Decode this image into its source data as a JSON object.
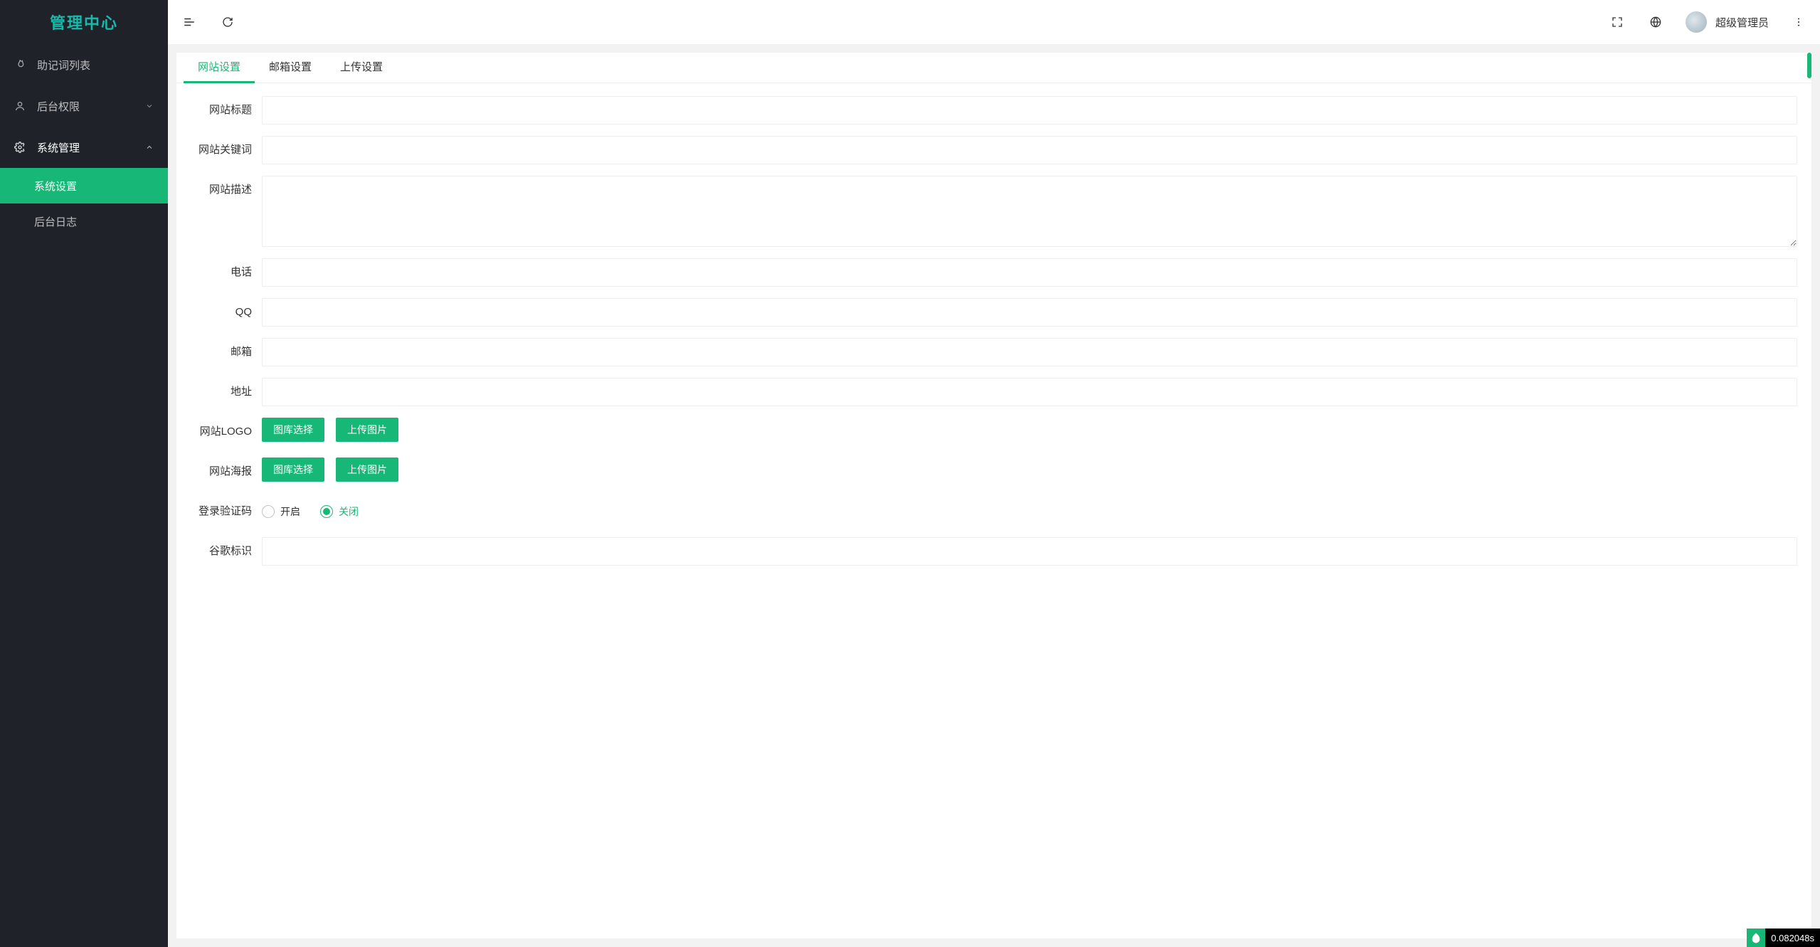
{
  "brand": {
    "title": "管理中心"
  },
  "sidebar": {
    "items": [
      {
        "label": "助记词列表",
        "icon": "flame",
        "expandable": false
      },
      {
        "label": "后台权限",
        "icon": "user",
        "expandable": true,
        "open": false
      },
      {
        "label": "系统管理",
        "icon": "gear",
        "expandable": true,
        "open": true,
        "children": [
          {
            "label": "系统设置",
            "active": true
          },
          {
            "label": "后台日志",
            "active": false
          }
        ]
      }
    ]
  },
  "topbar": {
    "username": "超级管理员"
  },
  "tabs": [
    {
      "label": "网站设置",
      "active": true
    },
    {
      "label": "邮箱设置",
      "active": false
    },
    {
      "label": "上传设置",
      "active": false
    }
  ],
  "form": {
    "site_title_label": "网站标题",
    "site_keywords_label": "网站关键词",
    "site_desc_label": "网站描述",
    "phone_label": "电话",
    "qq_label": "QQ",
    "email_label": "邮箱",
    "address_label": "地址",
    "logo_label": "网站LOGO",
    "poster_label": "网站海报",
    "captcha_label": "登录验证码",
    "google_label": "谷歌标识",
    "btn_gallery": "图库选择",
    "btn_upload": "上传图片",
    "radio_on": "开启",
    "radio_off": "关闭",
    "captcha_value": "off",
    "values": {
      "site_title": "",
      "site_keywords": "",
      "site_desc": "",
      "phone": "",
      "qq": "",
      "email": "",
      "address": "",
      "google": ""
    }
  },
  "timing": {
    "value": "0.082048s"
  }
}
